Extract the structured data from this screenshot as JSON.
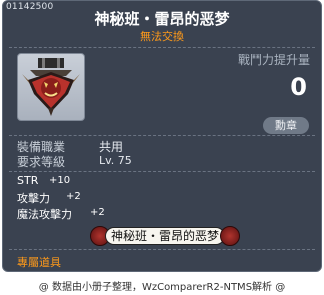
{
  "item": {
    "id": "01142500",
    "title": "神秘班・雷昂的恶梦",
    "trade_status": "無法交換",
    "icon_name": "dragon-medal-icon"
  },
  "combat_power": {
    "label": "戰鬥力提升量",
    "value": "0"
  },
  "medal_button": "勳章",
  "requirements": {
    "job_label": "裝備職業",
    "job_value": "共用",
    "level_label": "要求等級",
    "level_value": "Lv. 75"
  },
  "stats": [
    {
      "name": "STR",
      "value": "+10"
    },
    {
      "name": "攻擊力",
      "value": "+2"
    },
    {
      "name": "魔法攻擊力",
      "value": "+2"
    }
  ],
  "set_name": "神秘班・雷昂的恶梦",
  "exclusive_label": "專屬道具",
  "footer": "@ 数据由小册子整理，WzComparerR2-NTMS解析 @",
  "colors": {
    "tooltip_bg": "#3a4250",
    "title": "#ffffff",
    "trade_status": "#ff9a1a",
    "exclusive": "#ff9a1a",
    "power_label": "#a9b3bf"
  }
}
